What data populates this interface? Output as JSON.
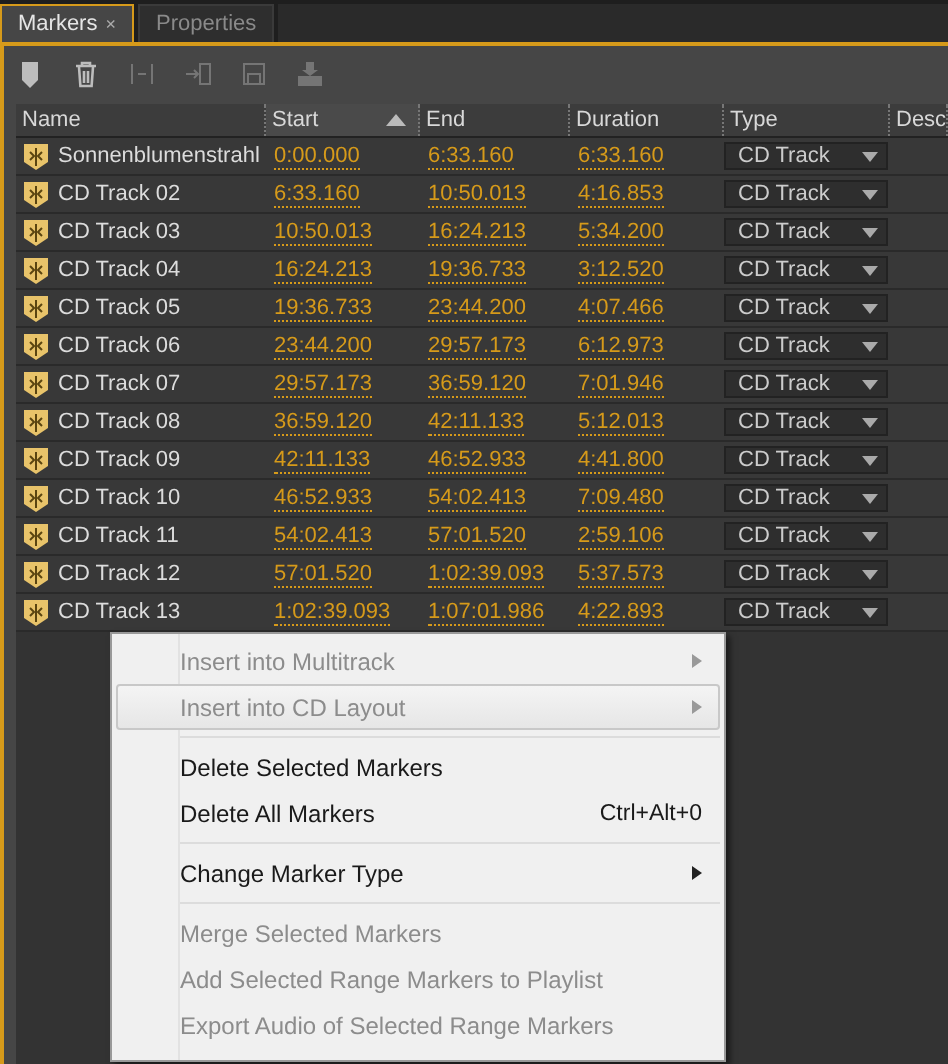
{
  "tabs": [
    {
      "label": "Markers",
      "selected": true,
      "close": "×"
    },
    {
      "label": "Properties",
      "selected": false
    }
  ],
  "toolbar": [
    {
      "kind": "marker",
      "disabled": false
    },
    {
      "kind": "trash",
      "disabled": false
    },
    {
      "kind": "merge",
      "disabled": true
    },
    {
      "kind": "insert",
      "disabled": true
    },
    {
      "kind": "save",
      "disabled": true
    },
    {
      "kind": "export",
      "disabled": true
    }
  ],
  "table": {
    "columns": [
      {
        "label": "Name",
        "sorted": false
      },
      {
        "label": "Start",
        "sorted": true
      },
      {
        "label": "End",
        "sorted": false
      },
      {
        "label": "Duration",
        "sorted": false
      },
      {
        "label": "Type",
        "sorted": false
      },
      {
        "label": "Desc",
        "sorted": false
      }
    ],
    "rows": [
      {
        "name": "Sonnenblumenstrahl",
        "start": "0:00.000",
        "end": "6:33.160",
        "duration": "6:33.160",
        "type": "CD Track"
      },
      {
        "name": "CD Track 02",
        "start": "6:33.160",
        "end": "10:50.013",
        "duration": "4:16.853",
        "type": "CD Track"
      },
      {
        "name": "CD Track 03",
        "start": "10:50.013",
        "end": "16:24.213",
        "duration": "5:34.200",
        "type": "CD Track"
      },
      {
        "name": "CD Track 04",
        "start": "16:24.213",
        "end": "19:36.733",
        "duration": "3:12.520",
        "type": "CD Track"
      },
      {
        "name": "CD Track 05",
        "start": "19:36.733",
        "end": "23:44.200",
        "duration": "4:07.466",
        "type": "CD Track"
      },
      {
        "name": "CD Track 06",
        "start": "23:44.200",
        "end": "29:57.173",
        "duration": "6:12.973",
        "type": "CD Track"
      },
      {
        "name": "CD Track 07",
        "start": "29:57.173",
        "end": "36:59.120",
        "duration": "7:01.946",
        "type": "CD Track"
      },
      {
        "name": "CD Track 08",
        "start": "36:59.120",
        "end": "42:11.133",
        "duration": "5:12.013",
        "type": "CD Track"
      },
      {
        "name": "CD Track 09",
        "start": "42:11.133",
        "end": "46:52.933",
        "duration": "4:41.800",
        "type": "CD Track"
      },
      {
        "name": "CD Track 10",
        "start": "46:52.933",
        "end": "54:02.413",
        "duration": "7:09.480",
        "type": "CD Track"
      },
      {
        "name": "CD Track 11",
        "start": "54:02.413",
        "end": "57:01.520",
        "duration": "2:59.106",
        "type": "CD Track"
      },
      {
        "name": "CD Track 12",
        "start": "57:01.520",
        "end": "1:02:39.093",
        "duration": "5:37.573",
        "type": "CD Track"
      },
      {
        "name": "CD Track 13",
        "start": "1:02:39.093",
        "end": "1:07:01.986",
        "duration": "4:22.893",
        "type": "CD Track"
      }
    ]
  },
  "context_menu": [
    {
      "kind": "item",
      "label": "Insert into Multitrack",
      "disabled": true,
      "submenu": true,
      "highlighted": false
    },
    {
      "kind": "item",
      "label": "Insert into CD Layout",
      "disabled": true,
      "submenu": true,
      "highlighted": true
    },
    {
      "kind": "separator"
    },
    {
      "kind": "item",
      "label": "Delete Selected Markers",
      "disabled": false,
      "submenu": false,
      "highlighted": false
    },
    {
      "kind": "item",
      "label": "Delete All Markers",
      "shortcut": "Ctrl+Alt+0",
      "disabled": false,
      "submenu": false,
      "highlighted": false
    },
    {
      "kind": "separator"
    },
    {
      "kind": "item",
      "label": "Change Marker Type",
      "disabled": false,
      "submenu": true,
      "highlighted": false
    },
    {
      "kind": "separator"
    },
    {
      "kind": "item",
      "label": "Merge Selected Markers",
      "disabled": true,
      "submenu": false,
      "highlighted": false
    },
    {
      "kind": "item",
      "label": "Add Selected Range Markers to Playlist",
      "disabled": true,
      "submenu": false,
      "highlighted": false
    },
    {
      "kind": "item",
      "label": "Export Audio of Selected Range Markers",
      "disabled": true,
      "submenu": false,
      "highlighted": false
    }
  ]
}
